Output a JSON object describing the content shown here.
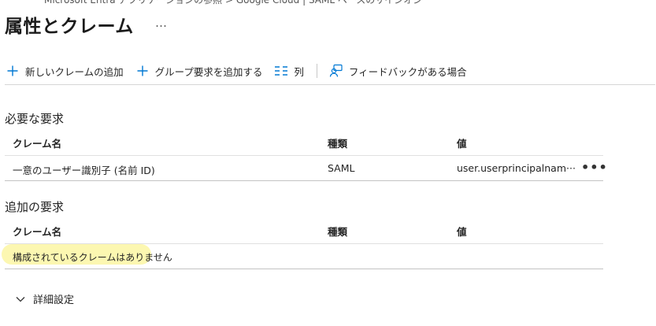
{
  "breadcrumb": "Microsoft Entra アプリケーションの参照 > Google Cloud | SAML ベースのサインオン",
  "page": {
    "title": "属性とクレーム",
    "more_label": "…"
  },
  "toolbar": {
    "add_claim_label": "新しいクレームの追加",
    "add_group_claim_label": "グループ要求を追加する",
    "columns_label": "列",
    "feedback_label": "フィードバックがある場合"
  },
  "required_claims": {
    "title": "必要な要求",
    "columns": [
      "クレーム名",
      "種類",
      "値"
    ],
    "rows": [
      {
        "name": "一意のユーザー識別子 (名前 ID)",
        "type": "SAML",
        "value": "user.userprincipalnam···"
      }
    ],
    "row_more_label": "•••"
  },
  "additional_claims": {
    "title": "追加の要求",
    "columns": [
      "クレーム名",
      "種類",
      "値"
    ],
    "empty_text": "構成されているクレームはありません"
  },
  "advanced": {
    "label": "詳細設定"
  },
  "icons": {
    "add": "plus-icon",
    "columns": "columns-icon",
    "feedback": "feedback-icon",
    "expand": "chevron-down-icon"
  },
  "colors": {
    "accent": "#0078d4",
    "highlight": "#fbf6a3"
  }
}
